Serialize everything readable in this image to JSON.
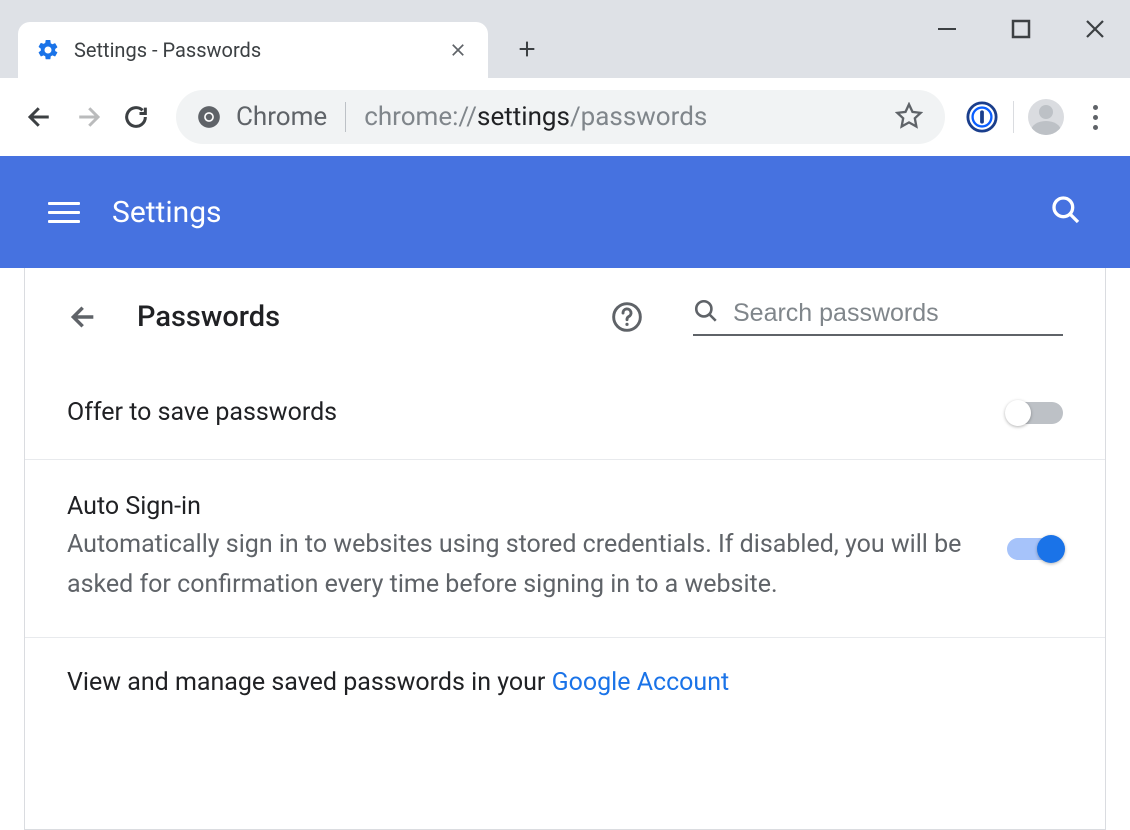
{
  "browser": {
    "tab_title": "Settings - Passwords",
    "omnibox_label": "Chrome",
    "url_prefix": "chrome://",
    "url_bold": "settings",
    "url_suffix": "/passwords"
  },
  "header": {
    "title": "Settings"
  },
  "page": {
    "heading": "Passwords",
    "search_placeholder": "Search passwords"
  },
  "settings": {
    "offer_save": {
      "label": "Offer to save passwords",
      "enabled": false
    },
    "auto_signin": {
      "label": "Auto Sign-in",
      "desc": "Automatically sign in to websites using stored credentials. If disabled, you will be asked for confirmation every time before signing in to a website.",
      "enabled": true
    },
    "manage": {
      "text": "View and manage saved passwords in your ",
      "link_text": "Google Account"
    }
  }
}
